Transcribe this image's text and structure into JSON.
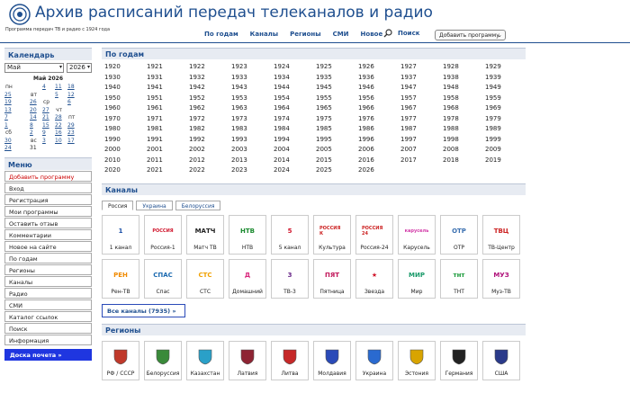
{
  "header": {
    "title": "Архив расписаний передач телеканалов и радио",
    "subtitle": "Программа передач ТВ и радио с 1924 года",
    "nav": [
      "По годам",
      "Каналы",
      "Регионы",
      "СМИ",
      "Новое"
    ],
    "search_label": "Поиск",
    "add_program": "Добавить программу"
  },
  "sidebar": {
    "calendar_title": "Календарь",
    "month": "Май",
    "year": "2026",
    "month_year": "Май 2026",
    "weekdays": [
      "пн",
      "вт",
      "ср",
      "чт",
      "пт",
      "сб",
      "вс"
    ],
    "weeks": [
      [
        "",
        "4",
        "11",
        "18",
        "25"
      ],
      [
        "",
        "5",
        "12",
        "19",
        "26"
      ],
      [
        "",
        "6",
        "13",
        "20",
        "27"
      ],
      [
        "",
        "7",
        "14",
        "21",
        "28"
      ],
      [
        "1",
        "8",
        "15",
        "22",
        "29"
      ],
      [
        "2",
        "9",
        "16",
        "23",
        "30"
      ],
      [
        "3",
        "10",
        "17",
        "24",
        "31"
      ]
    ],
    "menu_title": "Меню",
    "menu": [
      "Добавить программу",
      "Вход",
      "Регистрация",
      "Мои программы",
      "Оставить отзыв",
      "Комментарии",
      "Новое на сайте",
      "По годам",
      "Регионы",
      "Каналы",
      "Радио",
      "СМИ",
      "Каталог ссылок",
      "Поиск",
      "Информация"
    ],
    "board": "Доска почета »"
  },
  "main": {
    "years_title": "По годам",
    "years": [
      "1920",
      "1921",
      "1922",
      "1923",
      "1924",
      "1925",
      "1926",
      "1927",
      "1928",
      "1929",
      "1930",
      "1931",
      "1932",
      "1933",
      "1934",
      "1935",
      "1936",
      "1937",
      "1938",
      "1939",
      "1940",
      "1941",
      "1942",
      "1943",
      "1944",
      "1945",
      "1946",
      "1947",
      "1948",
      "1949",
      "1950",
      "1951",
      "1952",
      "1953",
      "1954",
      "1955",
      "1956",
      "1957",
      "1958",
      "1959",
      "1960",
      "1961",
      "1962",
      "1963",
      "1964",
      "1965",
      "1966",
      "1967",
      "1968",
      "1969",
      "1970",
      "1971",
      "1972",
      "1973",
      "1974",
      "1975",
      "1976",
      "1977",
      "1978",
      "1979",
      "1980",
      "1981",
      "1982",
      "1983",
      "1984",
      "1985",
      "1986",
      "1987",
      "1988",
      "1989",
      "1990",
      "1991",
      "1992",
      "1993",
      "1994",
      "1995",
      "1996",
      "1997",
      "1998",
      "1999",
      "2000",
      "2001",
      "2002",
      "2003",
      "2004",
      "2005",
      "2006",
      "2007",
      "2008",
      "2009",
      "2010",
      "2011",
      "2012",
      "2013",
      "2014",
      "2015",
      "2016",
      "2017",
      "2018",
      "2019",
      "2020",
      "2021",
      "2022",
      "2023",
      "2024",
      "2025",
      "2026"
    ],
    "channels_title": "Каналы",
    "tabs": [
      "Россия",
      "Украина",
      "Белоруссия"
    ],
    "channels": [
      {
        "label": "1 канал",
        "logo": "1",
        "color": "#1b4fa8"
      },
      {
        "label": "Россия-1",
        "logo": "РОССИЯ",
        "color": "#d0142b"
      },
      {
        "label": "Матч ТВ",
        "logo": "МАТЧ",
        "color": "#222"
      },
      {
        "label": "НТВ",
        "logo": "НТВ",
        "color": "#1a8a2e"
      },
      {
        "label": "5 канал",
        "logo": "5",
        "color": "#d0142b"
      },
      {
        "label": "Культура",
        "logo": "РОССИЯ К",
        "color": "#c22"
      },
      {
        "label": "Россия-24",
        "logo": "РОССИЯ 24",
        "color": "#c22"
      },
      {
        "label": "Карусель",
        "logo": "карусель",
        "color": "#d23ba8"
      },
      {
        "label": "ОТР",
        "logo": "ОТР",
        "color": "#3a6fb0"
      },
      {
        "label": "ТВ-Центр",
        "logo": "ТВЦ",
        "color": "#c22"
      },
      {
        "label": "Рен-ТВ",
        "logo": "РЕН",
        "color": "#f08a00"
      },
      {
        "label": "Спас",
        "logo": "СПАС",
        "color": "#1c6ab0"
      },
      {
        "label": "СТС",
        "logo": "СТС",
        "color": "#f0a000"
      },
      {
        "label": "Домашний",
        "logo": "Д",
        "color": "#d8237a"
      },
      {
        "label": "ТВ-3",
        "logo": "3",
        "color": "#6a2a8a"
      },
      {
        "label": "Пятница",
        "logo": "ПЯТ",
        "color": "#c2185b"
      },
      {
        "label": "Звезда",
        "logo": "★",
        "color": "#d0142b"
      },
      {
        "label": "Мир",
        "logo": "МИР",
        "color": "#1a9a6a"
      },
      {
        "label": "ТНТ",
        "logo": "тнт",
        "color": "#1a9a3a"
      },
      {
        "label": "Муз-ТВ",
        "logo": "МУЗ",
        "color": "#b0127a"
      }
    ],
    "all_channels": "Все каналы (7935) »",
    "regions_title": "Регионы",
    "regions": [
      {
        "label": "РФ / СССР",
        "color": "#c0392b"
      },
      {
        "label": "Белоруссия",
        "color": "#3a8a3a"
      },
      {
        "label": "Казахстан",
        "color": "#2aa0c8"
      },
      {
        "label": "Латвия",
        "color": "#8e2433"
      },
      {
        "label": "Литва",
        "color": "#c62828"
      },
      {
        "label": "Молдавия",
        "color": "#2a4ab8"
      },
      {
        "label": "Украина",
        "color": "#2a6ad0"
      },
      {
        "label": "Эстония",
        "color": "#d8a400"
      },
      {
        "label": "Германия",
        "color": "#222"
      },
      {
        "label": "США",
        "color": "#2a3a8a"
      }
    ]
  }
}
